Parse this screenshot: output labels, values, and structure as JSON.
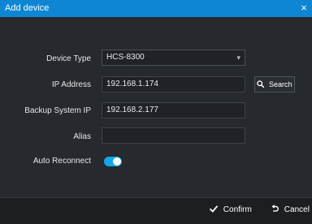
{
  "window": {
    "title": "Add device",
    "close_symbol": "×"
  },
  "form": {
    "device_type": {
      "label": "Device Type",
      "value": "HCS-8300",
      "caret": "▾"
    },
    "ip_address": {
      "label": "IP Address",
      "value": "192.168.1.174"
    },
    "backup_system_ip": {
      "label": "Backup System IP",
      "value": "192.168.2.177"
    },
    "alias": {
      "label": "Alias",
      "value": ""
    },
    "auto_reconnect": {
      "label": "Auto Reconnect",
      "enabled": true
    }
  },
  "buttons": {
    "search": {
      "label": "Search",
      "icon": "search-icon"
    },
    "confirm": {
      "label": "Confirm",
      "icon": "check-icon"
    },
    "cancel": {
      "label": "Cancel",
      "icon": "undo-icon"
    }
  },
  "colors": {
    "titlebar": "#0e86d4",
    "toggle_on": "#12a7e8",
    "background": "#26292d"
  }
}
